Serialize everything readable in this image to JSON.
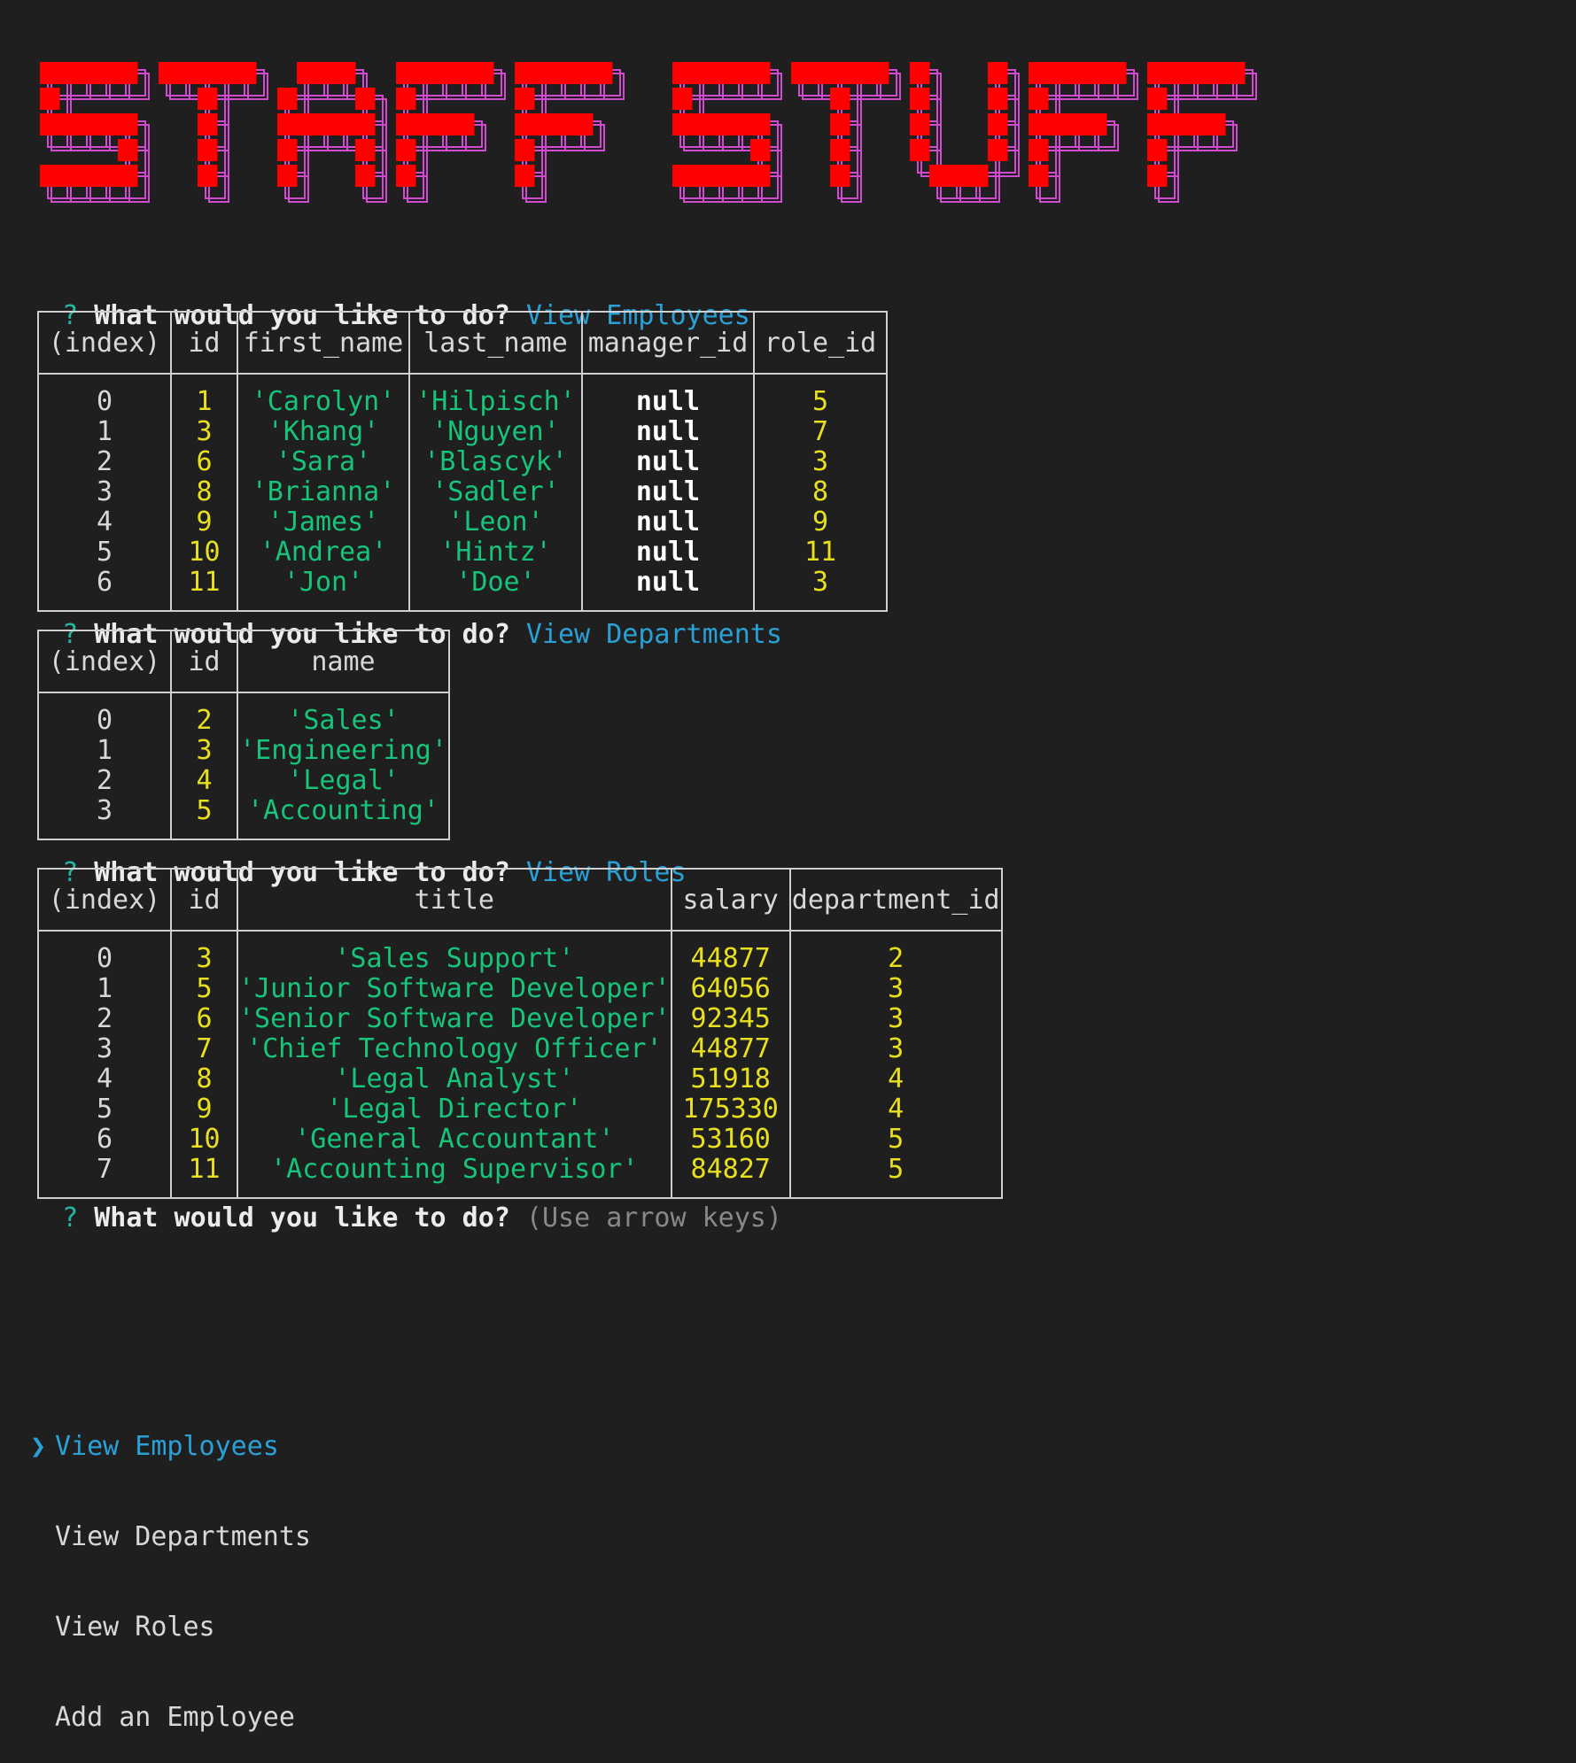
{
  "banner": {
    "text": "STAFF STUFF",
    "fill_color": "#ff0000",
    "outline_color": "#d04bd0"
  },
  "prompts": [
    {
      "mark": "?",
      "question": "What would you like to do?",
      "answer": "View Employees"
    },
    {
      "mark": "?",
      "question": "What would you like to do?",
      "answer": "View Departments"
    },
    {
      "mark": "?",
      "question": "What would you like to do?",
      "answer": "View Roles"
    },
    {
      "mark": "?",
      "question": "What would you like to do?",
      "hint": "(Use arrow keys)"
    }
  ],
  "employees_table": {
    "columns": [
      "(index)",
      "id",
      "first_name",
      "last_name",
      "manager_id",
      "role_id"
    ],
    "rows": [
      [
        "0",
        "1",
        "'Carolyn'",
        "'Hilpisch'",
        "null",
        "5"
      ],
      [
        "1",
        "3",
        "'Khang'",
        "'Nguyen'",
        "null",
        "7"
      ],
      [
        "2",
        "6",
        "'Sara'",
        "'Blascyk'",
        "null",
        "3"
      ],
      [
        "3",
        "8",
        "'Brianna'",
        "'Sadler'",
        "null",
        "8"
      ],
      [
        "4",
        "9",
        "'James'",
        "'Leon'",
        "null",
        "9"
      ],
      [
        "5",
        "10",
        "'Andrea'",
        "'Hintz'",
        "null",
        "11"
      ],
      [
        "6",
        "11",
        "'Jon'",
        "'Doe'",
        "null",
        "3"
      ]
    ]
  },
  "departments_table": {
    "columns": [
      "(index)",
      "id",
      "name"
    ],
    "rows": [
      [
        "0",
        "2",
        "'Sales'"
      ],
      [
        "1",
        "3",
        "'Engineering'"
      ],
      [
        "2",
        "4",
        "'Legal'"
      ],
      [
        "3",
        "5",
        "'Accounting'"
      ]
    ]
  },
  "roles_table": {
    "columns": [
      "(index)",
      "id",
      "title",
      "salary",
      "department_id"
    ],
    "rows": [
      [
        "0",
        "3",
        "'Sales Support'",
        "44877",
        "2"
      ],
      [
        "1",
        "5",
        "'Junior Software Developer'",
        "64056",
        "3"
      ],
      [
        "2",
        "6",
        "'Senior Software Developer'",
        "92345",
        "3"
      ],
      [
        "3",
        "7",
        "'Chief Technology Officer'",
        "44877",
        "3"
      ],
      [
        "4",
        "8",
        "'Legal Analyst'",
        "51918",
        "4"
      ],
      [
        "5",
        "9",
        "'Legal Director'",
        "175330",
        "4"
      ],
      [
        "6",
        "10",
        "'General Accountant'",
        "53160",
        "5"
      ],
      [
        "7",
        "11",
        "'Accounting Supervisor'",
        "84827",
        "5"
      ]
    ]
  },
  "menu": {
    "pointer": "❯",
    "items": [
      "View Employees",
      "View Departments",
      "View Roles",
      "Add an Employee"
    ]
  }
}
